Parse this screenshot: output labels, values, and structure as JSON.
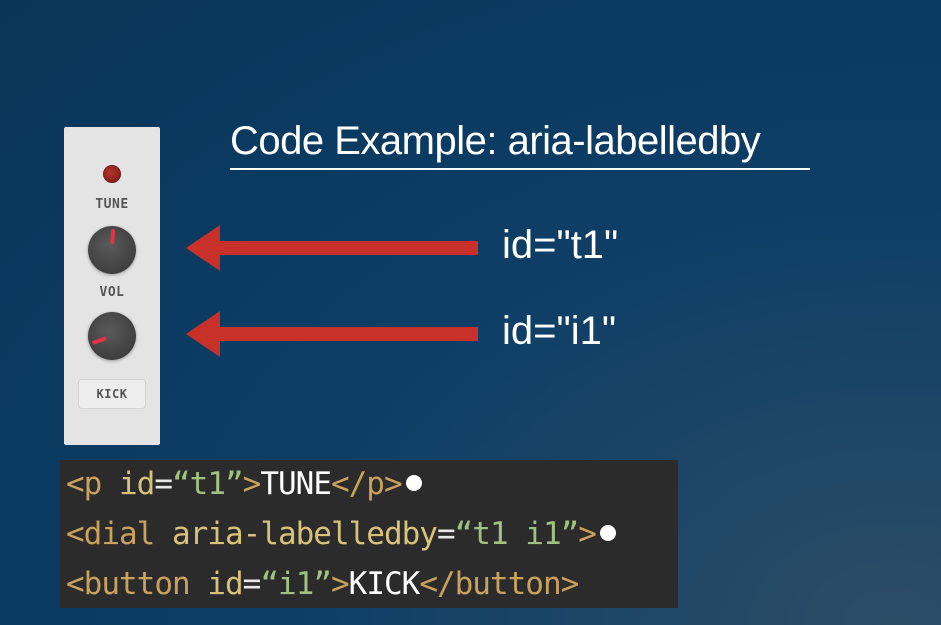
{
  "slide": {
    "title": "Code Example: aria-labelledby"
  },
  "device": {
    "tune_label": "TUNE",
    "vol_label": "VOL",
    "kick_label": "KICK"
  },
  "callouts": [
    {
      "text": "id=\"t1\""
    },
    {
      "text": "id=\"i1\""
    }
  ],
  "code": {
    "line1": {
      "open": "<p",
      "attr": "id",
      "eq": "=",
      "value": "“t1”",
      "close": ">",
      "text": "TUNE",
      "end": "</p>"
    },
    "line2": {
      "open": "<dial",
      "attr": "aria-labelledby",
      "eq": "=",
      "value": "“t1 i1”",
      "close": ">"
    },
    "line3": {
      "open": "<button",
      "attr": "id",
      "eq": "=",
      "value": "“i1”",
      "close": ">",
      "text": "KICK",
      "end": "</button>"
    }
  },
  "colors": {
    "arrow": "#c8312a",
    "knob_indicator": "#e0334a",
    "led": "#8a201b"
  },
  "icons": {
    "arrow": "left-arrow-icon",
    "led": "led-indicator",
    "knob": "dial-knob",
    "line_dot": "bullet-dot"
  }
}
